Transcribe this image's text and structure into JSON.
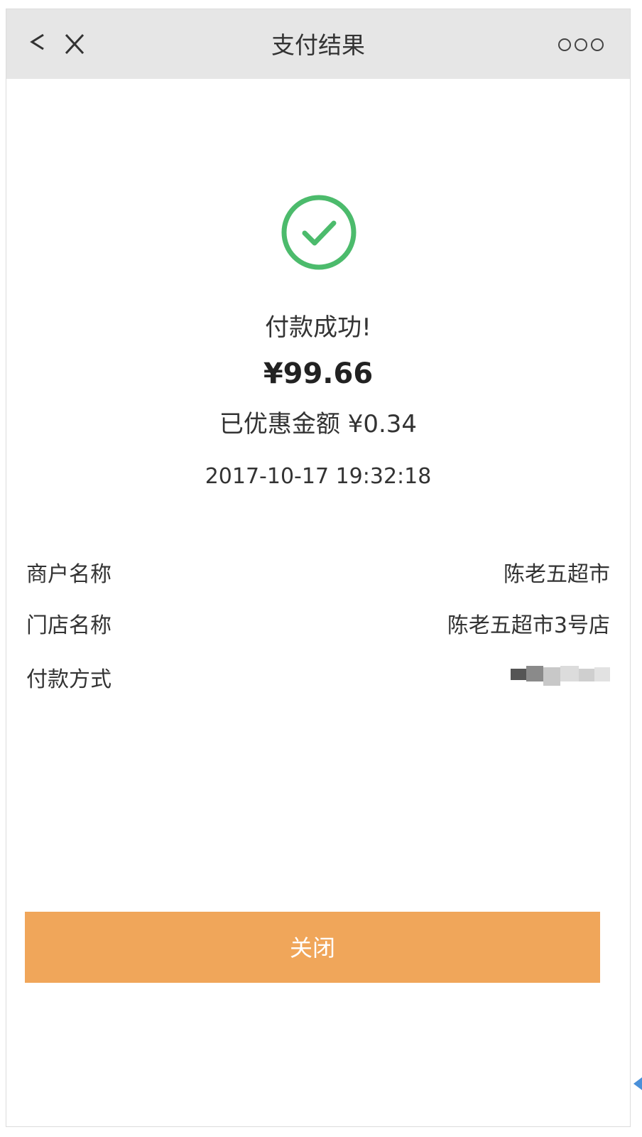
{
  "header": {
    "title": "支付结果",
    "back_icon": "chevron-left-icon",
    "close_icon": "close-x-icon",
    "more_icon": "more-dots-icon"
  },
  "result": {
    "status_icon": "check-circle-icon",
    "status": "付款成功!",
    "amount": "¥99.66",
    "discount": "已优惠金额 ¥0.34",
    "time": "2017-10-17 19:32:18"
  },
  "details": [
    {
      "label": "商户名称",
      "value": "陈老五超市"
    },
    {
      "label": "门店名称",
      "value": "陈老五超市3号店"
    },
    {
      "label": "付款方式",
      "value": ""
    }
  ],
  "footer": {
    "close_label": "关闭"
  },
  "colors": {
    "accent": "#f0a65a",
    "success": "#4cbb6c",
    "titlebar_bg": "#e6e6e6"
  }
}
